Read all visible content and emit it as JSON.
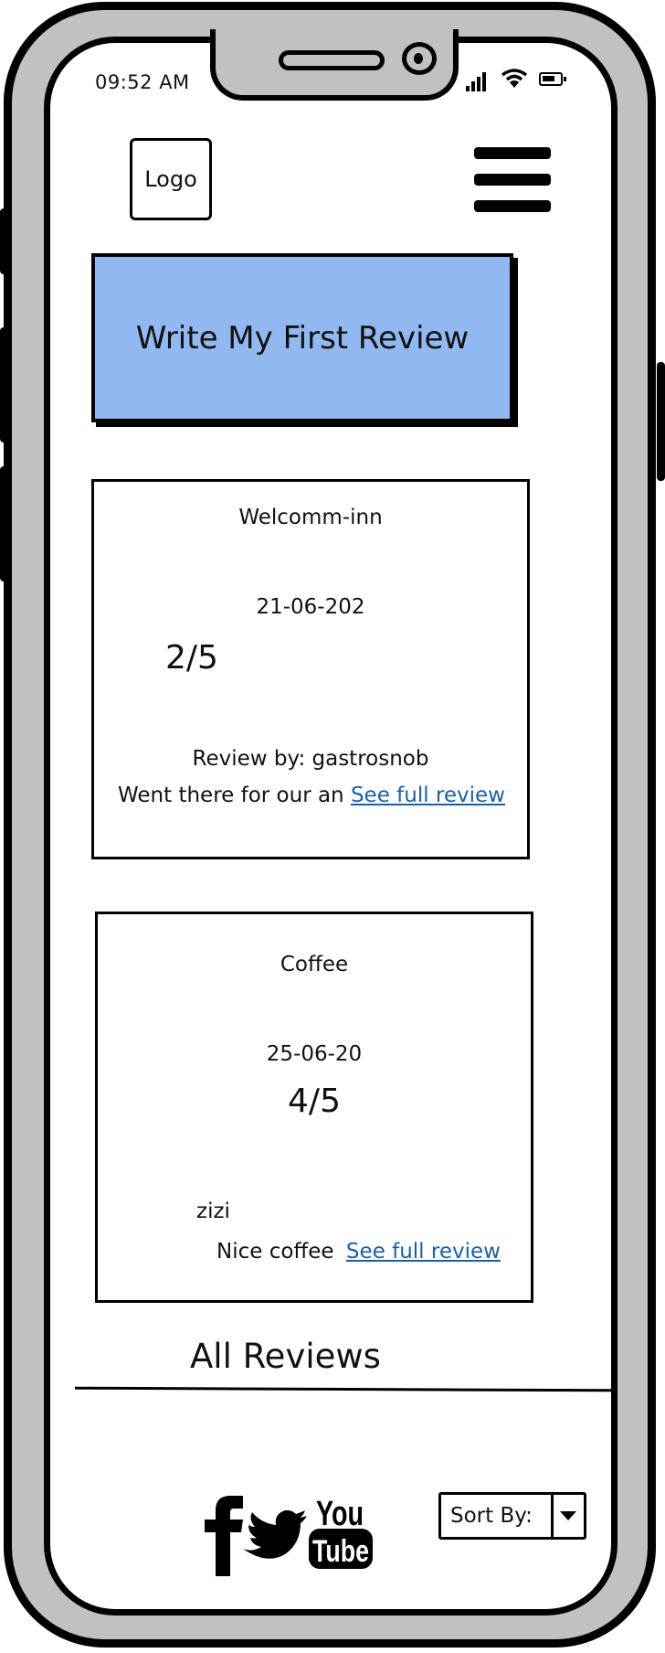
{
  "status_bar": {
    "time": "09:52 AM"
  },
  "header": {
    "logo_label": "Logo"
  },
  "cta": {
    "label": "Write My First Review"
  },
  "reviews": [
    {
      "title": "Welcomm-inn",
      "date": "21-06-202",
      "rating": "2/5",
      "author": "Review by: gastrosnob",
      "excerpt": "Went there for our an",
      "link": "See full review"
    },
    {
      "title": "Coffee",
      "date": "25-06-20",
      "rating": "4/5",
      "author": "zizi",
      "excerpt": "Nice coffee",
      "link": "See full review"
    }
  ],
  "section": {
    "title": "All Reviews"
  },
  "footer": {
    "youtube_you": "You",
    "youtube_tube": "Tube",
    "sort_label": "Sort By:"
  }
}
